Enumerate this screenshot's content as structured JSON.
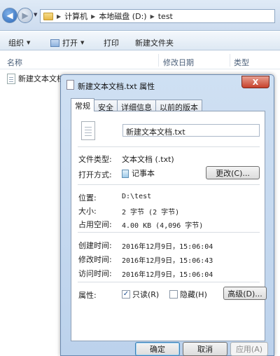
{
  "breadcrumb": [
    "计算机",
    "本地磁盘 (D:)",
    "test"
  ],
  "toolbar": {
    "organize": "组织",
    "open": "打开",
    "print": "打印",
    "new_folder": "新建文件夹"
  },
  "columns": {
    "name": "名称",
    "modified": "修改日期",
    "type": "类型"
  },
  "file": {
    "name": "新建文本文档..."
  },
  "dialog": {
    "title": "新建文本文档.txt 属性",
    "close": "X",
    "tabs": [
      "常规",
      "安全",
      "详细信息",
      "以前的版本"
    ],
    "filename": "新建文本文档.txt",
    "type_label": "文件类型:",
    "type_value": "文本文档 (.txt)",
    "open_with_label": "打开方式:",
    "open_with_value": "记事本",
    "change_button": "更改(C)...",
    "location_label": "位置:",
    "location_value": "D:\\test",
    "size_label": "大小:",
    "size_value": "2 字节 (2 字节)",
    "size_on_disk_label": "占用空间:",
    "size_on_disk_value": "4.00 KB (4,096 字节)",
    "created_label": "创建时间:",
    "created_value": "2016年12月9日，15:06:04",
    "modified_label": "修改时间:",
    "modified_value": "2016年12月9日，15:06:43",
    "accessed_label": "访问时间:",
    "accessed_value": "2016年12月9日，15:06:04",
    "attributes_label": "属性:",
    "readonly_label": "只读(R)",
    "readonly_checked": true,
    "hidden_label": "隐藏(H)",
    "hidden_checked": false,
    "advanced_button": "高级(D)...",
    "ok_button": "确定",
    "cancel_button": "取消",
    "apply_button": "应用(A)"
  }
}
